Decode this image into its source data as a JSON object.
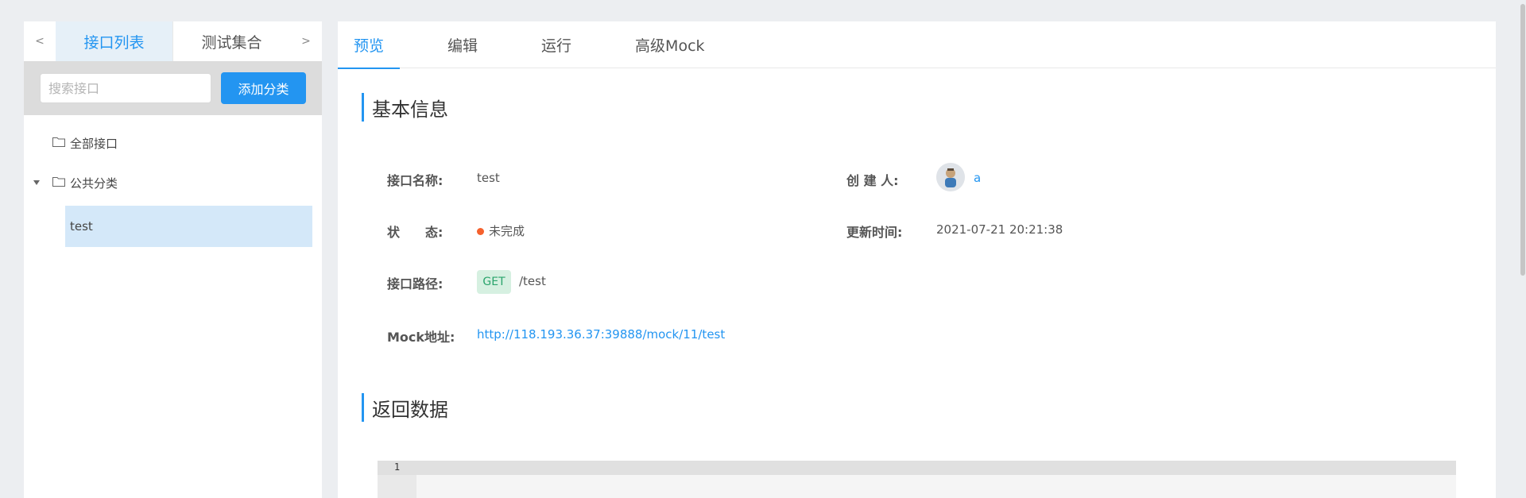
{
  "left_panel": {
    "prev_arrow": "<",
    "next_arrow": ">",
    "tabs": [
      {
        "label": "接口列表",
        "active": true
      },
      {
        "label": "测试集合",
        "active": false
      }
    ],
    "search": {
      "placeholder": "搜索接口",
      "value": ""
    },
    "add_category_button": "添加分类",
    "tree": {
      "all_interfaces": "全部接口",
      "category": {
        "label": "公共分类",
        "expanded": true,
        "items": [
          {
            "label": "test",
            "selected": true
          }
        ]
      }
    }
  },
  "right_panel": {
    "tabs": [
      {
        "label": "预览",
        "active": true
      },
      {
        "label": "编辑",
        "active": false
      },
      {
        "label": "运行",
        "active": false
      },
      {
        "label": "高级Mock",
        "active": false
      }
    ],
    "basic_info": {
      "title": "基本信息",
      "name_label": "接口名称:",
      "name_value": "test",
      "creator_label": "创 建 人:",
      "creator_value": "a",
      "status_label": "状　　态:",
      "status_value": "未完成",
      "updated_label": "更新时间:",
      "updated_value": "2021-07-21 20:21:38",
      "path_label": "接口路径:",
      "method": "GET",
      "path_value": "/test",
      "mock_label": "Mock地址:",
      "mock_value": "http://118.193.36.37:39888/mock/11/test"
    },
    "return_data": {
      "title": "返回数据",
      "editor_line_number": "1"
    }
  },
  "colors": {
    "accent": "#2395f1",
    "status_incomplete": "#f5612d",
    "method_get_bg": "#d6f0e1",
    "method_get_text": "#2aa46c"
  },
  "icons": [
    "folder-icon",
    "caret-down-icon",
    "chevron-left-icon",
    "chevron-right-icon",
    "status-dot-icon",
    "avatar"
  ]
}
